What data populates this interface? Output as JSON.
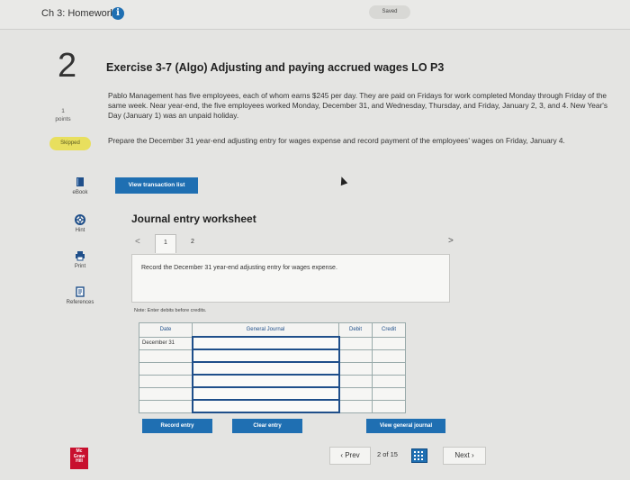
{
  "topbar": {
    "title": "Ch 3: Homework",
    "saved": "Saved"
  },
  "question": {
    "number": "2",
    "points_value": "1",
    "points_label": "points",
    "status": "Skipped"
  },
  "sidebar": {
    "tools": [
      {
        "label": "eBook",
        "icon": "book-icon"
      },
      {
        "label": "Hint",
        "icon": "lifebuoy-icon"
      },
      {
        "label": "Print",
        "icon": "printer-icon"
      },
      {
        "label": "References",
        "icon": "document-icon"
      }
    ]
  },
  "exercise": {
    "title": "Exercise 3-7 (Algo) Adjusting and paying accrued wages LO P3",
    "description": "Pablo Management has five employees, each of whom earns $245 per day. They are paid on Fridays for work completed Monday through Friday of the same week. Near year-end, the five employees worked Monday, December 31, and Wednesday, Thursday, and Friday, January 2, 3, and 4. New Year's Day (January 1) was an unpaid holiday.",
    "instruction": "Prepare the December 31 year-end adjusting entry for wages expense and record payment of the employees' wages on Friday, January 4."
  },
  "buttons": {
    "view_transaction_list": "View transaction list",
    "record_entry": "Record entry",
    "clear_entry": "Clear entry",
    "view_general_journal": "View general journal"
  },
  "worksheet": {
    "title": "Journal entry worksheet",
    "prev_arrow": "<",
    "next_arrow": ">",
    "tabs": [
      "1",
      "2"
    ],
    "record_text": "Record the December 31 year-end adjusting entry for wages expense.",
    "note": "Note: Enter debits before credits.",
    "columns": [
      "Date",
      "General Journal",
      "Debit",
      "Credit"
    ],
    "rows": [
      {
        "date": "December 31",
        "account": "",
        "debit": "",
        "credit": ""
      },
      {
        "date": "",
        "account": "",
        "debit": "",
        "credit": ""
      },
      {
        "date": "",
        "account": "",
        "debit": "",
        "credit": ""
      },
      {
        "date": "",
        "account": "",
        "debit": "",
        "credit": ""
      },
      {
        "date": "",
        "account": "",
        "debit": "",
        "credit": ""
      },
      {
        "date": "",
        "account": "",
        "debit": "",
        "credit": ""
      }
    ]
  },
  "footer": {
    "logo": [
      "Mc",
      "Graw",
      "Hill"
    ],
    "prev": "Prev",
    "page_current": "2",
    "page_of": "of 15",
    "next": "Next"
  }
}
